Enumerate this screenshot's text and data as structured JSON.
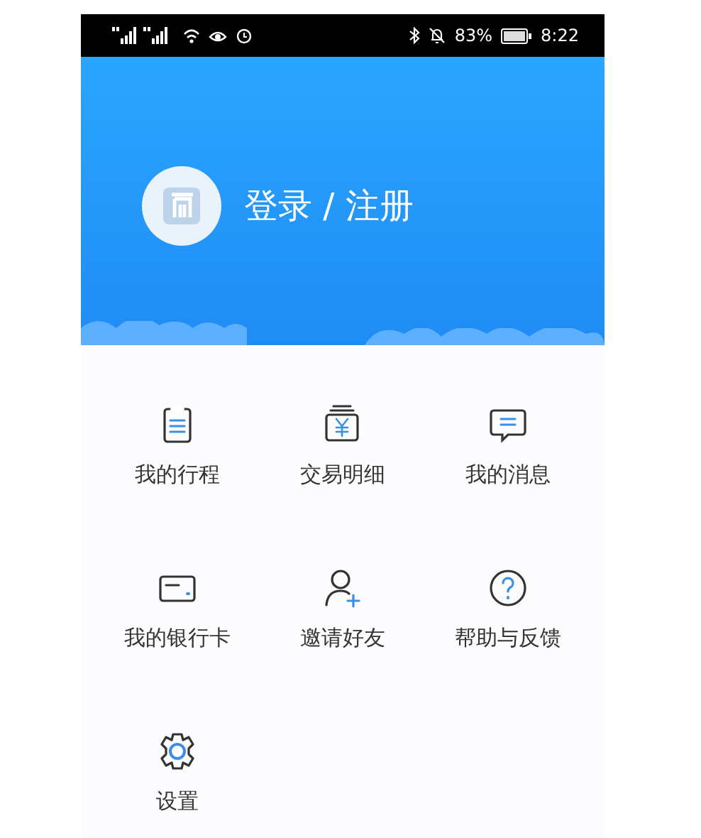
{
  "status_bar": {
    "battery_percent": "83%",
    "time": "8:22"
  },
  "header": {
    "login_label": "登录 / 注册"
  },
  "menu": [
    {
      "label": "我的行程",
      "kind": "trips"
    },
    {
      "label": "交易明细",
      "kind": "transactions"
    },
    {
      "label": "我的消息",
      "kind": "messages"
    },
    {
      "label": "我的银行卡",
      "kind": "card"
    },
    {
      "label": "邀请好友",
      "kind": "invite"
    },
    {
      "label": "帮助与反馈",
      "kind": "help"
    },
    {
      "label": "设置",
      "kind": "settings"
    }
  ]
}
